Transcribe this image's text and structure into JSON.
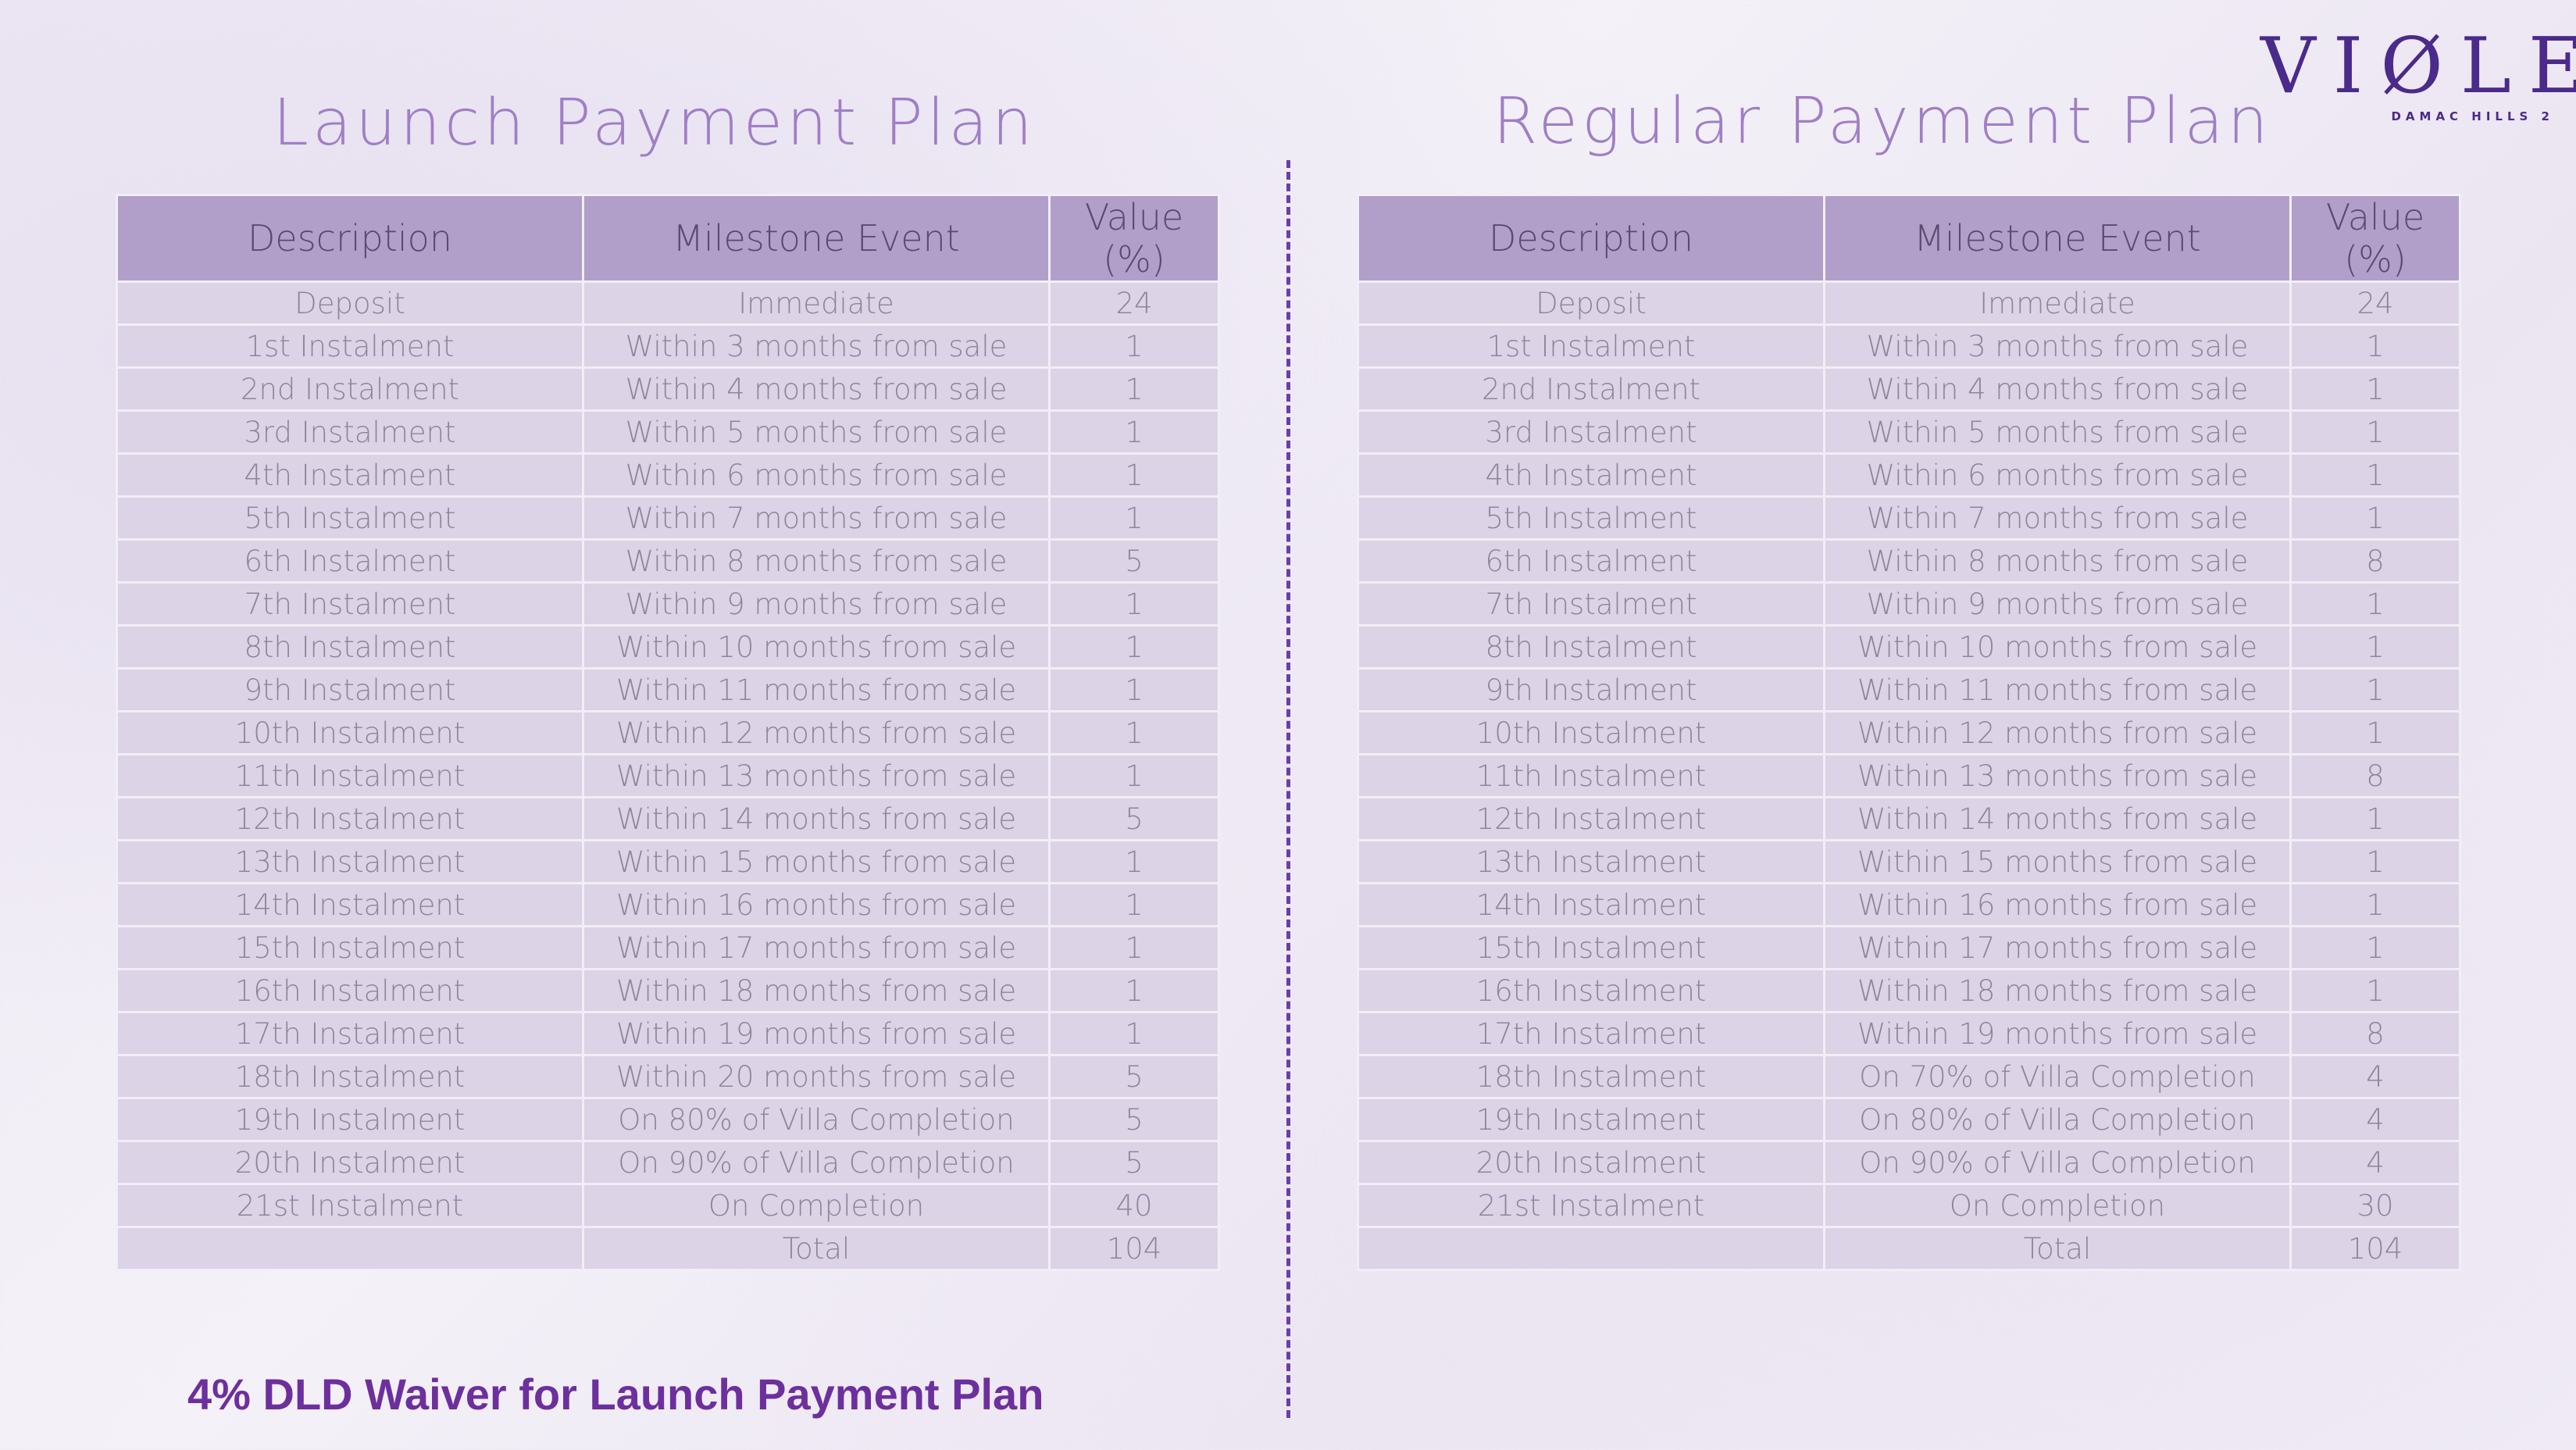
{
  "logo": {
    "wordmark": "VIØLET",
    "subtitle": "DAMAC HILLS 2"
  },
  "launch": {
    "title": "Launch Payment Plan",
    "headers": [
      "Description",
      "Milestone Event",
      "Value (%)"
    ],
    "rows": [
      [
        "Deposit",
        "Immediate",
        "24"
      ],
      [
        "1st Instalment",
        "Within 3 months from sale",
        "1"
      ],
      [
        "2nd Instalment",
        "Within 4 months from sale",
        "1"
      ],
      [
        "3rd Instalment",
        "Within 5 months from sale",
        "1"
      ],
      [
        "4th Instalment",
        "Within 6 months from sale",
        "1"
      ],
      [
        "5th Instalment",
        "Within 7 months from sale",
        "1"
      ],
      [
        "6th Instalment",
        "Within 8 months from sale",
        "5"
      ],
      [
        "7th Instalment",
        "Within 9 months from sale",
        "1"
      ],
      [
        "8th Instalment",
        "Within 10 months from sale",
        "1"
      ],
      [
        "9th Instalment",
        "Within 11 months from sale",
        "1"
      ],
      [
        "10th Instalment",
        "Within 12 months from sale",
        "1"
      ],
      [
        "11th Instalment",
        "Within 13 months from sale",
        "1"
      ],
      [
        "12th Instalment",
        "Within 14 months from sale",
        "5"
      ],
      [
        "13th Instalment",
        "Within 15 months from sale",
        "1"
      ],
      [
        "14th Instalment",
        "Within 16 months from sale",
        "1"
      ],
      [
        "15th Instalment",
        "Within 17 months from sale",
        "1"
      ],
      [
        "16th Instalment",
        "Within 18 months from sale",
        "1"
      ],
      [
        "17th Instalment",
        "Within 19 months from sale",
        "1"
      ],
      [
        "18th Instalment",
        "Within 20 months from sale",
        "5"
      ],
      [
        "19th Instalment",
        "On 80% of Villa Completion",
        "5"
      ],
      [
        "20th Instalment",
        "On 90% of Villa Completion",
        "5"
      ],
      [
        "21st Instalment",
        "On Completion",
        "40"
      ],
      [
        "",
        "Total",
        "104"
      ]
    ]
  },
  "regular": {
    "title": "Regular Payment Plan",
    "headers": [
      "Description",
      "Milestone Event",
      "Value (%)"
    ],
    "rows": [
      [
        "Deposit",
        "Immediate",
        "24"
      ],
      [
        "1st Instalment",
        "Within 3 months from sale",
        "1"
      ],
      [
        "2nd Instalment",
        "Within 4 months from sale",
        "1"
      ],
      [
        "3rd Instalment",
        "Within 5 months from sale",
        "1"
      ],
      [
        "4th Instalment",
        "Within 6 months from sale",
        "1"
      ],
      [
        "5th Instalment",
        "Within 7 months from sale",
        "1"
      ],
      [
        "6th Instalment",
        "Within 8 months from sale",
        "8"
      ],
      [
        "7th Instalment",
        "Within 9 months from sale",
        "1"
      ],
      [
        "8th Instalment",
        "Within 10 months from sale",
        "1"
      ],
      [
        "9th Instalment",
        "Within 11 months from sale",
        "1"
      ],
      [
        "10th Instalment",
        "Within 12 months from sale",
        "1"
      ],
      [
        "11th Instalment",
        "Within 13 months from sale",
        "8"
      ],
      [
        "12th Instalment",
        "Within 14 months from sale",
        "1"
      ],
      [
        "13th Instalment",
        "Within 15 months from sale",
        "1"
      ],
      [
        "14th Instalment",
        "Within 16 months from sale",
        "1"
      ],
      [
        "15th Instalment",
        "Within 17 months from sale",
        "1"
      ],
      [
        "16th Instalment",
        "Within 18 months from sale",
        "1"
      ],
      [
        "17th Instalment",
        "Within 19 months from sale",
        "8"
      ],
      [
        "18th Instalment",
        "On 70% of Villa Completion",
        "4"
      ],
      [
        "19th Instalment",
        "On 80% of Villa Completion",
        "4"
      ],
      [
        "20th Instalment",
        "On 90% of Villa Completion",
        "4"
      ],
      [
        "21st Instalment",
        "On Completion",
        "30"
      ],
      [
        "",
        "Total",
        "104"
      ]
    ]
  },
  "footer": {
    "waiver": "4% DLD Waiver for Launch Payment Plan"
  }
}
